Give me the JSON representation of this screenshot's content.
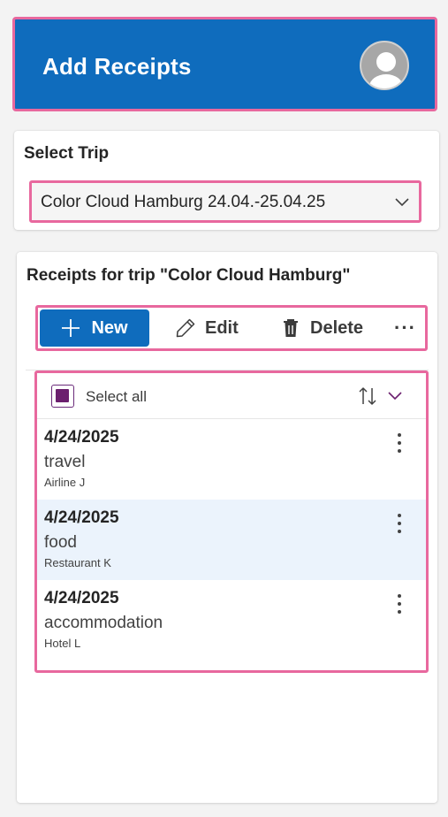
{
  "header": {
    "title": "Add Receipts",
    "avatar_icon": "person-icon"
  },
  "trip_selector": {
    "label": "Select Trip",
    "selected_value": "Color Cloud Hamburg 24.04.-25.04.25",
    "chevron_icon": "chevron-down-icon"
  },
  "receipts": {
    "title": "Receipts for trip \"Color Cloud Hamburg\"",
    "toolbar": {
      "new_label": "New",
      "edit_label": "Edit",
      "delete_label": "Delete",
      "more_label": "···"
    },
    "select_all_label": "Select all",
    "items": [
      {
        "date": "4/24/2025",
        "category": "travel",
        "vendor": "Airline J",
        "selected": false
      },
      {
        "date": "4/24/2025",
        "category": "food",
        "vendor": "Restaurant K",
        "selected": true
      },
      {
        "date": "4/24/2025",
        "category": "accommodation",
        "vendor": "Hotel L",
        "selected": false
      }
    ]
  },
  "colors": {
    "accent": "#0f6cbd",
    "highlight": "#e8689e",
    "checkbox": "#6b1f6e",
    "selected_row": "#ebf3fc"
  }
}
